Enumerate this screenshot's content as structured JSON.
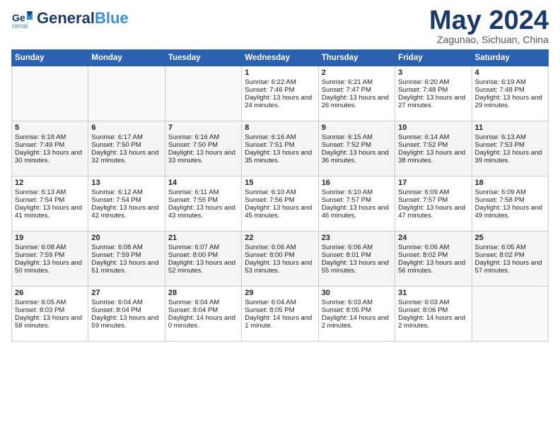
{
  "header": {
    "logo_main": "General",
    "logo_accent": "Blue",
    "month": "May 2024",
    "location": "Zagunao, Sichuan, China"
  },
  "weekdays": [
    "Sunday",
    "Monday",
    "Tuesday",
    "Wednesday",
    "Thursday",
    "Friday",
    "Saturday"
  ],
  "weeks": [
    [
      {
        "day": "",
        "sunrise": "",
        "sunset": "",
        "daylight": ""
      },
      {
        "day": "",
        "sunrise": "",
        "sunset": "",
        "daylight": ""
      },
      {
        "day": "",
        "sunrise": "",
        "sunset": "",
        "daylight": ""
      },
      {
        "day": "1",
        "sunrise": "Sunrise: 6:22 AM",
        "sunset": "Sunset: 7:46 PM",
        "daylight": "Daylight: 13 hours and 24 minutes."
      },
      {
        "day": "2",
        "sunrise": "Sunrise: 6:21 AM",
        "sunset": "Sunset: 7:47 PM",
        "daylight": "Daylight: 13 hours and 26 minutes."
      },
      {
        "day": "3",
        "sunrise": "Sunrise: 6:20 AM",
        "sunset": "Sunset: 7:48 PM",
        "daylight": "Daylight: 13 hours and 27 minutes."
      },
      {
        "day": "4",
        "sunrise": "Sunrise: 6:19 AM",
        "sunset": "Sunset: 7:48 PM",
        "daylight": "Daylight: 13 hours and 29 minutes."
      }
    ],
    [
      {
        "day": "5",
        "sunrise": "Sunrise: 6:18 AM",
        "sunset": "Sunset: 7:49 PM",
        "daylight": "Daylight: 13 hours and 30 minutes."
      },
      {
        "day": "6",
        "sunrise": "Sunrise: 6:17 AM",
        "sunset": "Sunset: 7:50 PM",
        "daylight": "Daylight: 13 hours and 32 minutes."
      },
      {
        "day": "7",
        "sunrise": "Sunrise: 6:16 AM",
        "sunset": "Sunset: 7:50 PM",
        "daylight": "Daylight: 13 hours and 33 minutes."
      },
      {
        "day": "8",
        "sunrise": "Sunrise: 6:16 AM",
        "sunset": "Sunset: 7:51 PM",
        "daylight": "Daylight: 13 hours and 35 minutes."
      },
      {
        "day": "9",
        "sunrise": "Sunrise: 6:15 AM",
        "sunset": "Sunset: 7:52 PM",
        "daylight": "Daylight: 13 hours and 36 minutes."
      },
      {
        "day": "10",
        "sunrise": "Sunrise: 6:14 AM",
        "sunset": "Sunset: 7:52 PM",
        "daylight": "Daylight: 13 hours and 38 minutes."
      },
      {
        "day": "11",
        "sunrise": "Sunrise: 6:13 AM",
        "sunset": "Sunset: 7:53 PM",
        "daylight": "Daylight: 13 hours and 39 minutes."
      }
    ],
    [
      {
        "day": "12",
        "sunrise": "Sunrise: 6:13 AM",
        "sunset": "Sunset: 7:54 PM",
        "daylight": "Daylight: 13 hours and 41 minutes."
      },
      {
        "day": "13",
        "sunrise": "Sunrise: 6:12 AM",
        "sunset": "Sunset: 7:54 PM",
        "daylight": "Daylight: 13 hours and 42 minutes."
      },
      {
        "day": "14",
        "sunrise": "Sunrise: 6:11 AM",
        "sunset": "Sunset: 7:55 PM",
        "daylight": "Daylight: 13 hours and 43 minutes."
      },
      {
        "day": "15",
        "sunrise": "Sunrise: 6:10 AM",
        "sunset": "Sunset: 7:56 PM",
        "daylight": "Daylight: 13 hours and 45 minutes."
      },
      {
        "day": "16",
        "sunrise": "Sunrise: 6:10 AM",
        "sunset": "Sunset: 7:57 PM",
        "daylight": "Daylight: 13 hours and 46 minutes."
      },
      {
        "day": "17",
        "sunrise": "Sunrise: 6:09 AM",
        "sunset": "Sunset: 7:57 PM",
        "daylight": "Daylight: 13 hours and 47 minutes."
      },
      {
        "day": "18",
        "sunrise": "Sunrise: 6:09 AM",
        "sunset": "Sunset: 7:58 PM",
        "daylight": "Daylight: 13 hours and 49 minutes."
      }
    ],
    [
      {
        "day": "19",
        "sunrise": "Sunrise: 6:08 AM",
        "sunset": "Sunset: 7:59 PM",
        "daylight": "Daylight: 13 hours and 50 minutes."
      },
      {
        "day": "20",
        "sunrise": "Sunrise: 6:08 AM",
        "sunset": "Sunset: 7:59 PM",
        "daylight": "Daylight: 13 hours and 51 minutes."
      },
      {
        "day": "21",
        "sunrise": "Sunrise: 6:07 AM",
        "sunset": "Sunset: 8:00 PM",
        "daylight": "Daylight: 13 hours and 52 minutes."
      },
      {
        "day": "22",
        "sunrise": "Sunrise: 6:06 AM",
        "sunset": "Sunset: 8:00 PM",
        "daylight": "Daylight: 13 hours and 53 minutes."
      },
      {
        "day": "23",
        "sunrise": "Sunrise: 6:06 AM",
        "sunset": "Sunset: 8:01 PM",
        "daylight": "Daylight: 13 hours and 55 minutes."
      },
      {
        "day": "24",
        "sunrise": "Sunrise: 6:06 AM",
        "sunset": "Sunset: 8:02 PM",
        "daylight": "Daylight: 13 hours and 56 minutes."
      },
      {
        "day": "25",
        "sunrise": "Sunrise: 6:05 AM",
        "sunset": "Sunset: 8:02 PM",
        "daylight": "Daylight: 13 hours and 57 minutes."
      }
    ],
    [
      {
        "day": "26",
        "sunrise": "Sunrise: 6:05 AM",
        "sunset": "Sunset: 8:03 PM",
        "daylight": "Daylight: 13 hours and 58 minutes."
      },
      {
        "day": "27",
        "sunrise": "Sunrise: 6:04 AM",
        "sunset": "Sunset: 8:04 PM",
        "daylight": "Daylight: 13 hours and 59 minutes."
      },
      {
        "day": "28",
        "sunrise": "Sunrise: 6:04 AM",
        "sunset": "Sunset: 8:04 PM",
        "daylight": "Daylight: 14 hours and 0 minutes."
      },
      {
        "day": "29",
        "sunrise": "Sunrise: 6:04 AM",
        "sunset": "Sunset: 8:05 PM",
        "daylight": "Daylight: 14 hours and 1 minute."
      },
      {
        "day": "30",
        "sunrise": "Sunrise: 6:03 AM",
        "sunset": "Sunset: 8:05 PM",
        "daylight": "Daylight: 14 hours and 2 minutes."
      },
      {
        "day": "31",
        "sunrise": "Sunrise: 6:03 AM",
        "sunset": "Sunset: 8:06 PM",
        "daylight": "Daylight: 14 hours and 2 minutes."
      },
      {
        "day": "",
        "sunrise": "",
        "sunset": "",
        "daylight": ""
      }
    ]
  ]
}
